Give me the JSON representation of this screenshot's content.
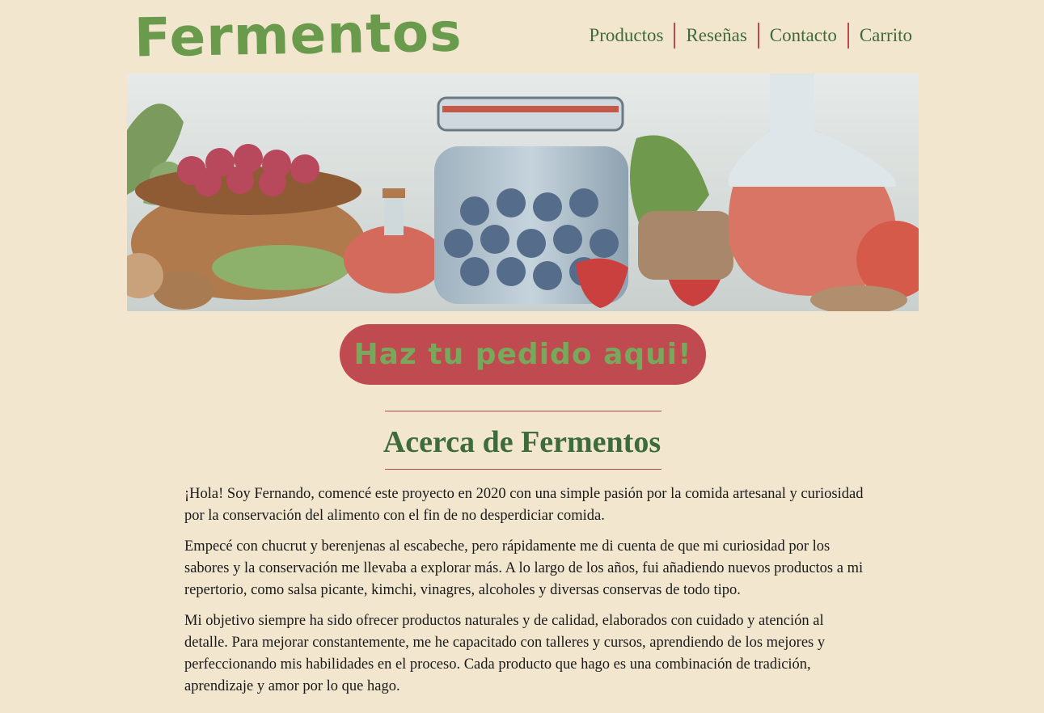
{
  "brand": {
    "logo": "Fermentos"
  },
  "nav": {
    "items": [
      "Productos",
      "Reseñas",
      "Contacto",
      "Carrito"
    ]
  },
  "hero": {
    "image": "fermented-foods-illustration"
  },
  "cta": {
    "label": "Haz tu pedido aqui!"
  },
  "about": {
    "title": "Acerca de Fermentos",
    "paragraphs": [
      "¡Hola! Soy Fernando, comencé este proyecto en 2020 con una simple pasión por la comida artesanal y curiosidad por la conservación del alimento con el fin de no desperdiciar comida.",
      "Empecé con chucrut y berenjenas al escabeche, pero rápidamente me di cuenta de que mi curiosidad por los sabores y la conservación me llevaba a explorar más. A lo largo de los años, fui añadiendo nuevos productos a mi repertorio, como salsa picante, kimchi, vinagres, alcoholes y diversas conservas de todo tipo.",
      "Mi objetivo siempre ha sido ofrecer productos naturales y de calidad, elaborados con cuidado y atención al detalle. Para mejorar constantemente, me he capacitado con talleres y cursos, aprendiendo de los mejores y perfeccionando mis habilidades en el proceso. Cada producto que hago es una combinación de tradición, aprendizaje y amor por lo que hago."
    ]
  },
  "colors": {
    "background": "#f2e6cf",
    "brand_green": "#6a9a4c",
    "text_green": "#3e6b3c",
    "accent_red": "#bf4a4f"
  }
}
